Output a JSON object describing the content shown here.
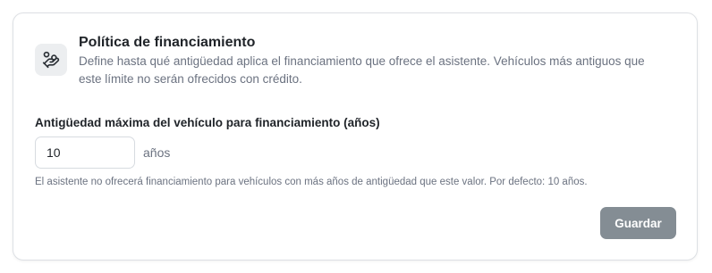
{
  "policy": {
    "title": "Política de financiamiento",
    "description": "Define hasta qué antigüedad aplica el financiamiento que ofrece el asistente. Vehículos más antiguos que este límite no serán ofrecidos con crédito.",
    "icon": "hand-coin-icon"
  },
  "field": {
    "label": "Antigüedad máxima del vehículo para financiamiento (años)",
    "value": "10",
    "unit": "años",
    "hint": "El asistente no ofrecerá financiamiento para vehículos con más años de antigüedad que este valor. Por defecto: 10 años."
  },
  "actions": {
    "save_label": "Guardar"
  },
  "colors": {
    "accent_button": "#848d94",
    "icon_background": "#eceef0",
    "border": "#dde0e4"
  }
}
